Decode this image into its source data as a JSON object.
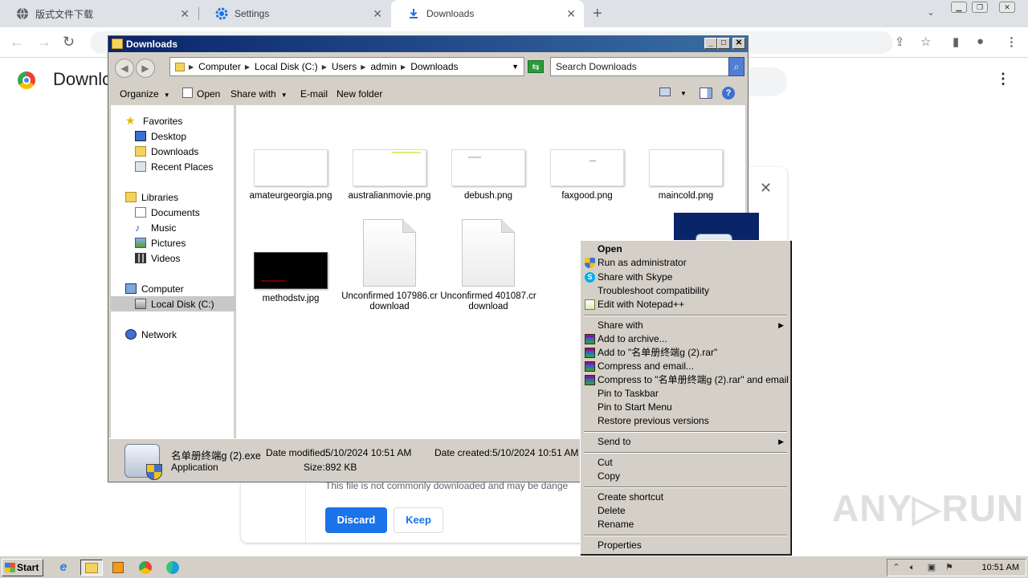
{
  "browser": {
    "tabs": [
      {
        "label": "版式文件下载",
        "icon": "globe-icon"
      },
      {
        "label": "Settings",
        "icon": "gear-icon"
      },
      {
        "label": "Downloads",
        "icon": "download-icon"
      }
    ],
    "page_title": "Downlo"
  },
  "download_card": {
    "warning_text": "This file is not commonly downloaded and may be dange",
    "discard_label": "Discard",
    "keep_label": "Keep"
  },
  "explorer": {
    "title": "Downloads",
    "breadcrumbs": [
      "Computer",
      "Local Disk (C:)",
      "Users",
      "admin",
      "Downloads"
    ],
    "search_placeholder": "Search Downloads",
    "commands": {
      "organize": "Organize",
      "open": "Open",
      "share_with": "Share with",
      "email": "E-mail",
      "new_folder": "New folder"
    },
    "nav": {
      "favorites": "Favorites",
      "desktop": "Desktop",
      "downloads": "Downloads",
      "recent_places": "Recent Places",
      "libraries": "Libraries",
      "documents": "Documents",
      "music": "Music",
      "pictures": "Pictures",
      "videos": "Videos",
      "computer": "Computer",
      "local_disk": "Local Disk (C:)",
      "network": "Network"
    },
    "files": [
      {
        "name": "amateurgeorgia.png"
      },
      {
        "name": "australianmovie.png"
      },
      {
        "name": "debush.png"
      },
      {
        "name": "faxgood.png"
      },
      {
        "name": "maincold.png"
      },
      {
        "name": "methodstv.jpg"
      },
      {
        "name": "Unconfirmed 107986.crdownload"
      },
      {
        "name": "Unconfirmed 401087.crdownload"
      },
      {
        "name": "名单册终端g (2).exe",
        "label_visible": "名单",
        "selected": true
      }
    ],
    "details": {
      "filename": "名单册终端g (2).exe",
      "type": "Application",
      "date_modified_label": "Date modified:",
      "date_modified": "5/10/2024 10:51 AM",
      "date_created_label": "Date created:",
      "date_created": "5/10/2024 10:51 AM",
      "size_label": "Size:",
      "size": "892 KB"
    }
  },
  "context_menu": {
    "open": "Open",
    "run_as_admin": "Run as administrator",
    "share_skype": "Share with Skype",
    "troubleshoot": "Troubleshoot compatibility",
    "edit_npp": "Edit with Notepad++",
    "share_with": "Share with",
    "add_archive": "Add to archive...",
    "add_to_rar": "Add to \"名单册终端g (2).rar\"",
    "compress_email": "Compress and email...",
    "compress_to_rar_email": "Compress to \"名单册终端g (2).rar\" and email",
    "pin_taskbar": "Pin to Taskbar",
    "pin_start": "Pin to Start Menu",
    "restore_versions": "Restore previous versions",
    "send_to": "Send to",
    "cut": "Cut",
    "copy": "Copy",
    "create_shortcut": "Create shortcut",
    "delete": "Delete",
    "rename": "Rename",
    "properties": "Properties"
  },
  "taskbar": {
    "start_label": "Start",
    "clock": "10:51 AM"
  },
  "watermark": "ANY RUN"
}
